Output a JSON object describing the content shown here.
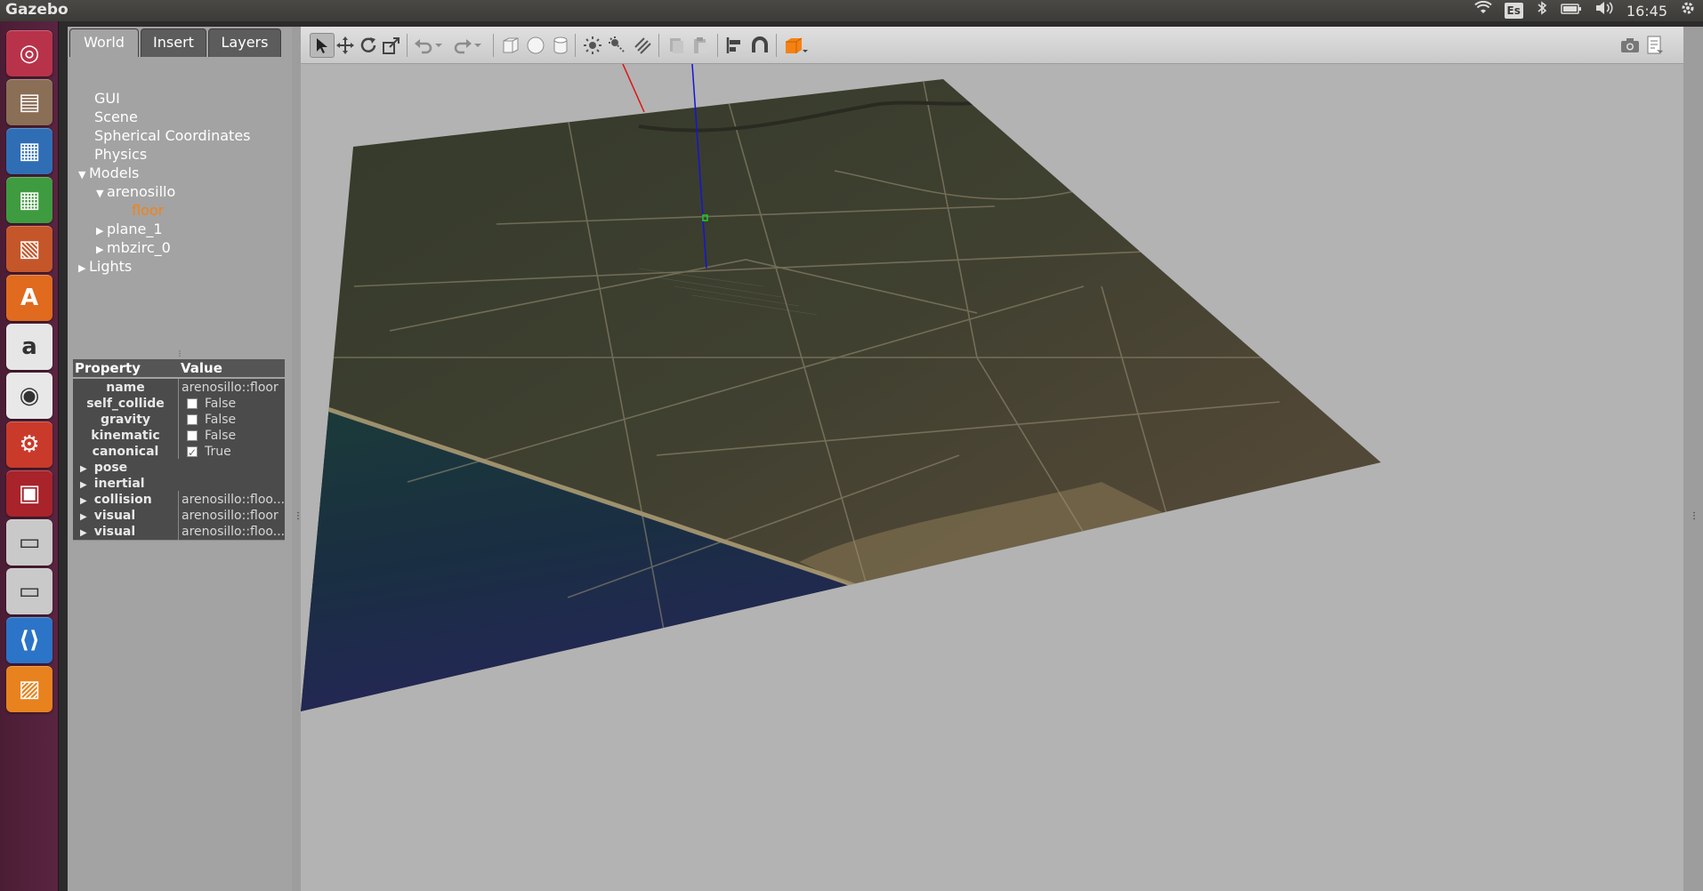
{
  "app_title": "Gazebo",
  "system": {
    "keyboard_layout": "Es",
    "clock": "16:45",
    "icons": [
      "wifi-icon",
      "keyboard-icon",
      "bluetooth-icon",
      "battery-icon",
      "volume-icon",
      "gear-icon"
    ]
  },
  "launcher": [
    {
      "name": "ubuntu-dash-icon",
      "color": "#b8334a"
    },
    {
      "name": "files-icon",
      "color": "#8a6e55"
    },
    {
      "name": "writer-icon",
      "color": "#2f6eb5"
    },
    {
      "name": "calc-icon",
      "color": "#3f9b3f"
    },
    {
      "name": "impress-icon",
      "color": "#c4562a"
    },
    {
      "name": "software-center-icon",
      "color": "#e06a1e"
    },
    {
      "name": "amazon-icon",
      "color": "#e6e6e6"
    },
    {
      "name": "chrome-icon",
      "color": "#e8e8e8"
    },
    {
      "name": "settings-icon",
      "color": "#c93a2a"
    },
    {
      "name": "system-monitor-icon",
      "color": "#a8232a"
    },
    {
      "name": "disk-icon-1",
      "color": "#c9c9c9"
    },
    {
      "name": "disk-icon-2",
      "color": "#c9c9c9"
    },
    {
      "name": "vscode-icon",
      "color": "#2b74c8"
    },
    {
      "name": "gazebo-icon",
      "color": "#e8821e"
    }
  ],
  "tabs": [
    "World",
    "Insert",
    "Layers"
  ],
  "tree": {
    "gui": "GUI",
    "scene": "Scene",
    "spherical": "Spherical Coordinates",
    "physics": "Physics",
    "models": "Models",
    "arenosillo": "arenosillo",
    "floor": "floor",
    "plane_1": "plane_1",
    "mbzirc_0": "mbzirc_0",
    "lights": "Lights"
  },
  "properties": {
    "header_property": "Property",
    "header_value": "Value",
    "rows": [
      {
        "name": "name",
        "value": "arenosillo::floor"
      },
      {
        "name": "self_collide",
        "value": "False",
        "checked": false
      },
      {
        "name": "gravity",
        "value": "False",
        "checked": false
      },
      {
        "name": "kinematic",
        "value": "False",
        "checked": false
      },
      {
        "name": "canonical",
        "value": "True",
        "checked": true
      }
    ],
    "sections": [
      {
        "name": "pose",
        "value": ""
      },
      {
        "name": "inertial",
        "value": ""
      },
      {
        "name": "collision",
        "value": "arenosillo::floo..."
      },
      {
        "name": "visual",
        "value": "arenosillo::floor"
      },
      {
        "name": "visual",
        "value": "arenosillo::floo..."
      }
    ]
  },
  "colors": {
    "selected_tree_item": "#f58113",
    "scene_background": "#b3b3b3",
    "toolbar_accent": "#f58113"
  }
}
